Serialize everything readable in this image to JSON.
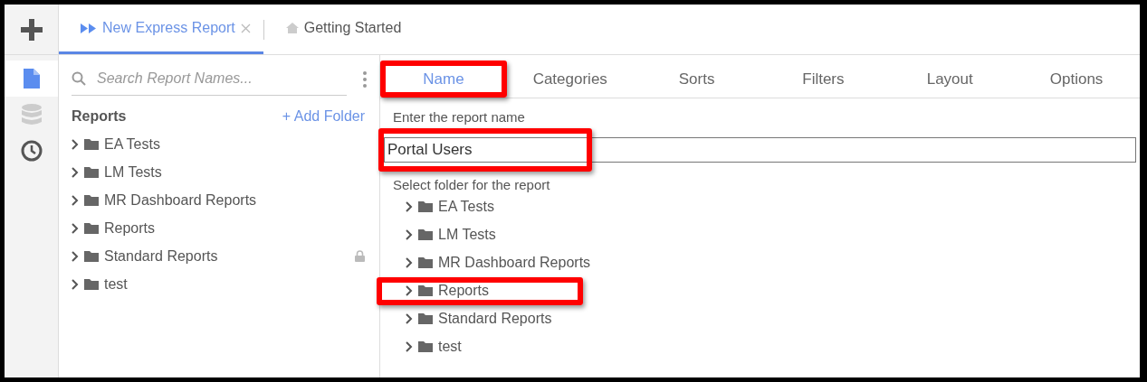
{
  "tabs": [
    {
      "label": "New Express Report",
      "selected": true,
      "closable": true
    },
    {
      "label": "Getting Started",
      "selected": false,
      "closable": false
    }
  ],
  "rail": [
    {
      "kind": "report",
      "selected": true
    },
    {
      "kind": "data",
      "selected": false
    },
    {
      "kind": "history",
      "selected": false
    }
  ],
  "sidebar": {
    "search_placeholder": "Search Report Names...",
    "heading": "Reports",
    "add_folder": "+ Add Folder",
    "folders": [
      {
        "name": "EA Tests",
        "locked": false
      },
      {
        "name": "LM Tests",
        "locked": false
      },
      {
        "name": "MR Dashboard Reports",
        "locked": false
      },
      {
        "name": "Reports",
        "locked": false
      },
      {
        "name": "Standard Reports",
        "locked": true
      },
      {
        "name": "test",
        "locked": false
      }
    ]
  },
  "steps": [
    {
      "label": "Name",
      "selected": true,
      "highlighted": true
    },
    {
      "label": "Categories",
      "selected": false,
      "highlighted": false
    },
    {
      "label": "Sorts",
      "selected": false,
      "highlighted": false
    },
    {
      "label": "Filters",
      "selected": false,
      "highlighted": false
    },
    {
      "label": "Layout",
      "selected": false,
      "highlighted": false
    },
    {
      "label": "Options",
      "selected": false,
      "highlighted": false
    }
  ],
  "name_form": {
    "label": "Enter the report name",
    "value": "Portal Users",
    "highlighted": true
  },
  "folder_picker": {
    "label": "Select folder for the report",
    "folders": [
      {
        "name": "EA Tests",
        "highlighted": false
      },
      {
        "name": "LM Tests",
        "highlighted": false
      },
      {
        "name": "MR Dashboard Reports",
        "highlighted": false
      },
      {
        "name": "Reports",
        "highlighted": true
      },
      {
        "name": "Standard Reports",
        "highlighted": false
      },
      {
        "name": "test",
        "highlighted": false
      }
    ]
  }
}
